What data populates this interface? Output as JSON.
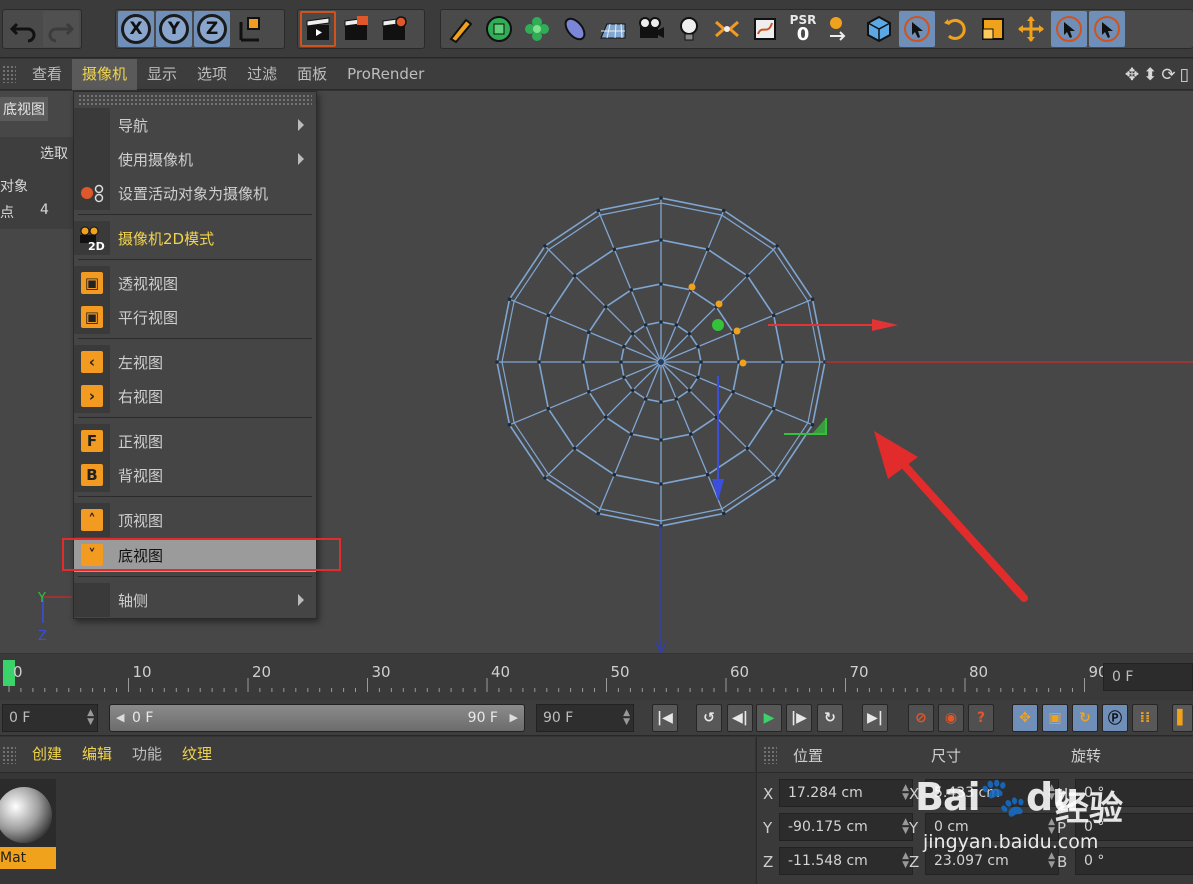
{
  "toolbar": {
    "axis_x": "X",
    "axis_y": "Y",
    "axis_z": "Z",
    "psr_label": "PSR",
    "psr_value": "0"
  },
  "menubar": {
    "items": [
      "查看",
      "摄像机",
      "显示",
      "选项",
      "过滤",
      "面板",
      "ProRender"
    ],
    "active_index": 1
  },
  "viewport": {
    "view_label": "底视图",
    "hud": {
      "selection_label": "选取",
      "object_label": "对象",
      "points_label": "点",
      "points_value": "4"
    },
    "axis_y": "Y",
    "axis_z": "Z"
  },
  "camera_menu": {
    "items": [
      {
        "label": "导航",
        "submenu": true,
        "icon": "none"
      },
      {
        "label": "使用摄像机",
        "submenu": true,
        "icon": "none"
      },
      {
        "label": "设置活动对象为摄像机",
        "submenu": false,
        "icon": "set-camera-icon"
      },
      {
        "label": "摄像机2D模式",
        "submenu": false,
        "icon": "camera-2d-icon"
      },
      {
        "label": "透视视图",
        "submenu": false,
        "icon": "cube-icon"
      },
      {
        "label": "平行视图",
        "submenu": false,
        "icon": "cube-icon"
      },
      {
        "label": "左视图",
        "submenu": false,
        "icon": "chevron-left-icon"
      },
      {
        "label": "右视图",
        "submenu": false,
        "icon": "chevron-right-icon"
      },
      {
        "label": "正视图",
        "submenu": false,
        "icon": "letter-f-icon"
      },
      {
        "label": "背视图",
        "submenu": false,
        "icon": "letter-b-icon"
      },
      {
        "label": "顶视图",
        "submenu": false,
        "icon": "chevron-up-icon"
      },
      {
        "label": "底视图",
        "submenu": false,
        "icon": "chevron-down-icon"
      },
      {
        "label": "轴侧",
        "submenu": true,
        "icon": "none"
      }
    ],
    "highlighted_index": 11,
    "icon_letter_f": "F",
    "icon_letter_b": "B",
    "icon_2d": "2D"
  },
  "timeline": {
    "ticks": [
      "0",
      "10",
      "20",
      "30",
      "40",
      "50",
      "60",
      "70",
      "80",
      "90"
    ],
    "current_frame_marker": 0,
    "current_frame_field": "0 F"
  },
  "transport": {
    "start_frame": "0 F",
    "range_start": "0 F",
    "range_end": "90 F",
    "end_frame": "90 F"
  },
  "material_panel": {
    "menu": [
      "创建",
      "编辑",
      "功能",
      "纹理"
    ],
    "material_name": "Mat"
  },
  "coordinates": {
    "headers": [
      "位置",
      "尺寸",
      "旋转"
    ],
    "axis_labels": [
      "X",
      "Y",
      "Z"
    ],
    "position": [
      "17.284 cm",
      "-90.175 cm",
      "-11.548 cm"
    ],
    "size_labels": [
      "X",
      "Y",
      "Z"
    ],
    "size": [
      "5.433 cm",
      "0 cm",
      "23.097 cm"
    ],
    "rotation_labels": [
      "H",
      "P",
      "B"
    ],
    "rotation": [
      "0 °",
      "0 °",
      "0 °"
    ]
  },
  "watermark": {
    "logo": "Bai",
    "logo_suffix": "du",
    "text": "经验",
    "url": "jingyan.baidu.com"
  },
  "colors": {
    "accent_yellow": "#f1d44c",
    "menu_highlight": "#9b9b9b",
    "annotation_red": "#e22b2b",
    "wireframe": "#7fa6d3"
  }
}
